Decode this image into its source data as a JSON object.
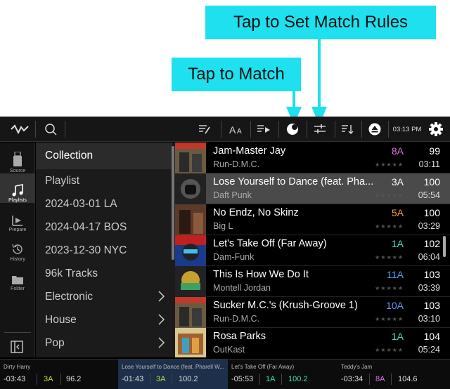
{
  "annotations": {
    "match_rules": "Tap to Set Match Rules",
    "match": "Tap to Match"
  },
  "topbar": {
    "clock": "03:13 PM"
  },
  "sidebar": {
    "items": [
      {
        "label": "Source",
        "icon": "source-icon"
      },
      {
        "label": "Playlists",
        "icon": "music-note-icon",
        "active": true
      },
      {
        "label": "Prepare",
        "icon": "prepare-icon"
      },
      {
        "label": "History",
        "icon": "history-icon"
      },
      {
        "label": "Folder",
        "icon": "folder-icon"
      }
    ]
  },
  "nav": {
    "items": [
      {
        "label": "Collection",
        "active": true
      },
      {
        "label": "Playlist"
      },
      {
        "label": "2024-03-01 LA"
      },
      {
        "label": "2024-04-17 BOS"
      },
      {
        "label": "2023-12-30 NYC"
      },
      {
        "label": "96k Tracks"
      },
      {
        "label": "Electronic",
        "has_children": true
      },
      {
        "label": "House",
        "has_children": true
      },
      {
        "label": "Pop",
        "has_children": true
      }
    ]
  },
  "tracks": [
    {
      "title": "Jam-Master Jay",
      "artist": "Run-D.M.C.",
      "key": "8A",
      "key_color": "#e070e8",
      "bpm": "99",
      "time": "03:11",
      "stars": "★★★★★"
    },
    {
      "title": "Lose Yourself to Dance (feat. Pha...",
      "artist": "Daft Punk",
      "key": "3A",
      "key_color": "#ffffff",
      "bpm": "100",
      "time": "05:54",
      "stars": "★★★★★",
      "playing": true
    },
    {
      "title": "No Endz, No Skinz",
      "artist": "Big L",
      "key": "5A",
      "key_color": "#f0a050",
      "bpm": "100",
      "time": "03:29",
      "stars": "★★★★★"
    },
    {
      "title": "Let's Take Off (Far Away)",
      "artist": "Dam-Funk",
      "key": "1A",
      "key_color": "#40e0c0",
      "bpm": "102",
      "time": "06:04",
      "stars": "★★★★★"
    },
    {
      "title": "This Is How We Do It",
      "artist": "Montell Jordan",
      "key": "11A",
      "key_color": "#40a8f0",
      "bpm": "103",
      "time": "03:39",
      "stars": "★★★★★"
    },
    {
      "title": "Sucker M.C.'s (Krush-Groove 1)",
      "artist": "Run-D.M.C.",
      "key": "10A",
      "key_color": "#7090f0",
      "bpm": "103",
      "time": "03:10",
      "stars": "★★★★★"
    },
    {
      "title": "Rosa Parks",
      "artist": "OutKast",
      "key": "1A",
      "key_color": "#40e0c0",
      "bpm": "104",
      "time": "05:24",
      "stars": "★★★★★"
    }
  ],
  "decks": [
    {
      "title": "Dirty Harry",
      "time": "-03:43",
      "key": "3A",
      "key_color": "#b0e040",
      "bpm": "96.2"
    },
    {
      "title": "Lose Yourself to Dance (feat. Pharell W...",
      "time": "-01:43",
      "key": "3A",
      "key_color": "#b0e040",
      "bpm": "100.2"
    },
    {
      "title": "Let's Take Off (Far Away)",
      "time": "-05:53",
      "key": "1A",
      "key_color": "#40e0c0",
      "bpm": "100.2",
      "bpm_color": "#40e0a0"
    },
    {
      "title": "Teddy's Jam",
      "time": "-03:34",
      "key": "8A",
      "key_color": "#e070e8",
      "bpm": "104.6"
    }
  ]
}
